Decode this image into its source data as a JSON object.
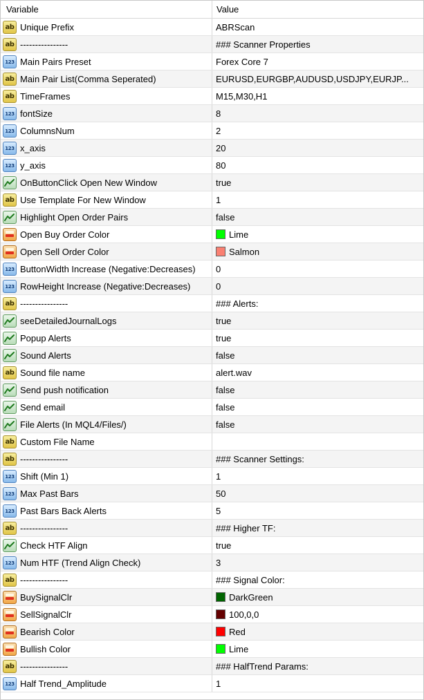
{
  "header": {
    "variable": "Variable",
    "value": "Value"
  },
  "rows": [
    {
      "type": "ab",
      "name": "Unique Prefix",
      "value": "ABRScan"
    },
    {
      "type": "ab",
      "name": "----------------",
      "value": "### Scanner Properties"
    },
    {
      "type": "123",
      "name": "Main Pairs Preset",
      "value": "Forex Core 7"
    },
    {
      "type": "ab",
      "name": "Main Pair List(Comma Seperated)",
      "value": "EURUSD,EURGBP,AUDUSD,USDJPY,EURJP..."
    },
    {
      "type": "ab",
      "name": "TimeFrames",
      "value": "M15,M30,H1"
    },
    {
      "type": "123",
      "name": "fontSize",
      "value": "8"
    },
    {
      "type": "123",
      "name": "ColumnsNum",
      "value": "2"
    },
    {
      "type": "123",
      "name": "x_axis",
      "value": "20"
    },
    {
      "type": "123",
      "name": "y_axis",
      "value": "80"
    },
    {
      "type": "bool",
      "name": "OnButtonClick Open New Window",
      "value": "true"
    },
    {
      "type": "ab",
      "name": "Use Template For New Window",
      "value": "1"
    },
    {
      "type": "bool",
      "name": "Highlight Open Order Pairs",
      "value": "false"
    },
    {
      "type": "color",
      "name": "Open Buy Order Color",
      "value": "Lime",
      "swatch": "#00ff00"
    },
    {
      "type": "color",
      "name": "Open Sell Order Color",
      "value": "Salmon",
      "swatch": "#fa8072"
    },
    {
      "type": "123",
      "name": "ButtonWidth Increase (Negative:Decreases)",
      "value": "0"
    },
    {
      "type": "123",
      "name": "RowHeight Increase (Negative:Decreases)",
      "value": "0"
    },
    {
      "type": "ab",
      "name": "----------------",
      "value": "### Alerts:"
    },
    {
      "type": "bool",
      "name": "seeDetailedJournalLogs",
      "value": "true"
    },
    {
      "type": "bool",
      "name": "Popup Alerts",
      "value": "true"
    },
    {
      "type": "bool",
      "name": "Sound Alerts",
      "value": "false"
    },
    {
      "type": "ab",
      "name": "Sound file name",
      "value": "alert.wav"
    },
    {
      "type": "bool",
      "name": "Send push notification",
      "value": "false"
    },
    {
      "type": "bool",
      "name": "Send email",
      "value": "false"
    },
    {
      "type": "bool",
      "name": "File Alerts (In MQL4/Files/)",
      "value": "false"
    },
    {
      "type": "ab",
      "name": "Custom File Name",
      "value": ""
    },
    {
      "type": "ab",
      "name": "----------------",
      "value": "### Scanner Settings:"
    },
    {
      "type": "123",
      "name": "Shift (Min 1)",
      "value": "1"
    },
    {
      "type": "123",
      "name": "Max Past Bars",
      "value": "50"
    },
    {
      "type": "123",
      "name": "Past Bars Back Alerts",
      "value": "5"
    },
    {
      "type": "ab",
      "name": "----------------",
      "value": "### Higher TF:"
    },
    {
      "type": "bool",
      "name": "Check HTF Align",
      "value": "true"
    },
    {
      "type": "123",
      "name": "Num HTF (Trend Align Check)",
      "value": "3"
    },
    {
      "type": "ab",
      "name": "----------------",
      "value": "### Signal Color:"
    },
    {
      "type": "color",
      "name": "BuySignalClr",
      "value": "DarkGreen",
      "swatch": "#006400"
    },
    {
      "type": "color",
      "name": "SellSignalClr",
      "value": "100,0,0",
      "swatch": "#640000"
    },
    {
      "type": "color",
      "name": "Bearish Color",
      "value": "Red",
      "swatch": "#ff0000"
    },
    {
      "type": "color",
      "name": "Bullish Color",
      "value": "Lime",
      "swatch": "#00ff00"
    },
    {
      "type": "ab",
      "name": "----------------",
      "value": "### HalfTrend Params:"
    },
    {
      "type": "123",
      "name": "Half Trend_Amplitude",
      "value": "1"
    }
  ],
  "icon_labels": {
    "ab": "ab",
    "123": "123"
  }
}
